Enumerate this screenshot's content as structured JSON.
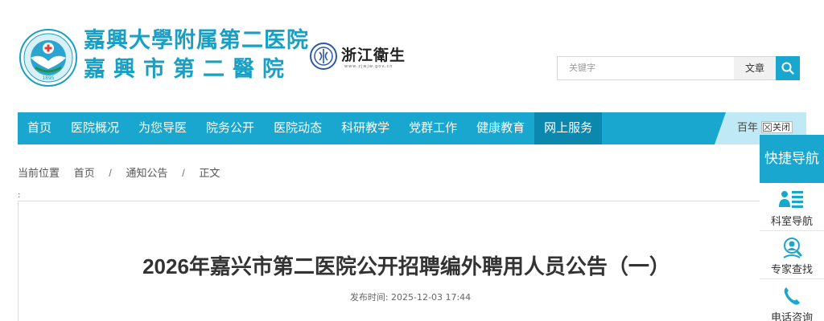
{
  "header": {
    "hospital_name_line1": "嘉興大學附属第二医院",
    "hospital_name_line2": "嘉興市第二醫院",
    "emblem_year": "1895",
    "partner_logo_text": "浙江衛生",
    "partner_logo_sub": "www.zjwjw.gov.cn"
  },
  "search": {
    "placeholder": "关键字",
    "type_label": "文章",
    "button_icon": "search-icon"
  },
  "nav": {
    "items": [
      {
        "label": "首页"
      },
      {
        "label": "医院概况"
      },
      {
        "label": "为您导医"
      },
      {
        "label": "院务公开"
      },
      {
        "label": "医院动态"
      },
      {
        "label": "科研教学"
      },
      {
        "label": "党群工作"
      },
      {
        "label": "健康教育"
      },
      {
        "label": "网上服务"
      }
    ],
    "active_index": 8,
    "right_text": "百年"
  },
  "close_tag": {
    "label": "关闭"
  },
  "breadcrumb": {
    "label": "当前位置",
    "items": [
      "首页",
      "通知公告",
      "正文"
    ],
    "separator": "/"
  },
  "article": {
    "title": "2026年嘉兴市第二医院公开招聘编外聘用人员公告（一）",
    "meta_label": "发布时间:",
    "publish_time": "2025-12-03 17:44"
  },
  "quick_panel": {
    "title": "快捷导航",
    "items": [
      {
        "label": "科室导航",
        "icon": "department-list-icon"
      },
      {
        "label": "专家查找",
        "icon": "doctor-search-icon"
      },
      {
        "label": "电话咨询",
        "icon": "phone-icon"
      }
    ]
  },
  "colors": {
    "brand": "#1aa7cf",
    "nav_active": "#0c87ad",
    "nav_right_bg": "#bfe9f4"
  }
}
